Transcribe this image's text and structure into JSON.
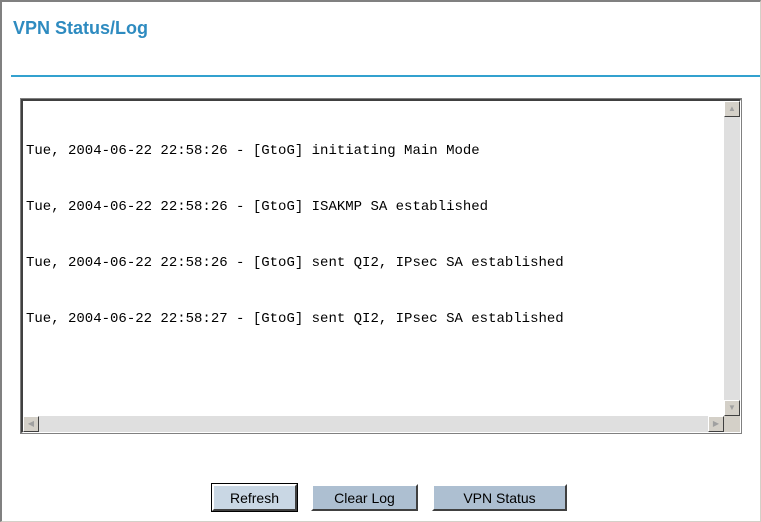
{
  "page": {
    "title": "VPN Status/Log"
  },
  "log": {
    "lines": [
      "Tue, 2004-06-22 22:58:26 - [GtoG] initiating Main Mode",
      "Tue, 2004-06-22 22:58:26 - [GtoG] ISAKMP SA established",
      "Tue, 2004-06-22 22:58:26 - [GtoG] sent QI2, IPsec SA established",
      "Tue, 2004-06-22 22:58:27 - [GtoG] sent QI2, IPsec SA established"
    ]
  },
  "buttons": {
    "refresh": "Refresh",
    "clear_log": "Clear Log",
    "vpn_status": "VPN Status"
  },
  "colors": {
    "title": "#2e8bc0",
    "rule": "#33a1cf",
    "button": "#adbfd1"
  },
  "icons": {
    "scroll_up": "triangle-up",
    "scroll_down": "triangle-down",
    "scroll_left": "triangle-left",
    "scroll_right": "triangle-right"
  }
}
